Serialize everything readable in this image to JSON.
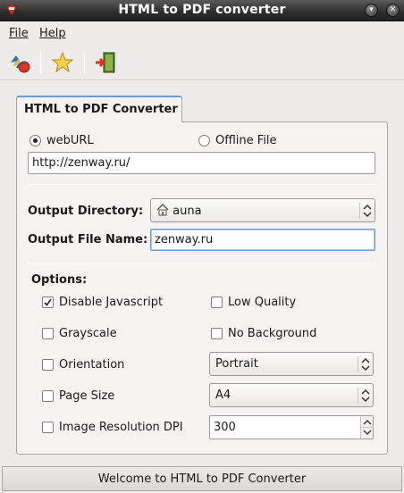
{
  "window": {
    "title": "HTML to PDF converter"
  },
  "menu": {
    "file": "File",
    "help": "Help"
  },
  "toolbar": {
    "convert_icon": "convert-icon",
    "favorite_icon": "star-icon",
    "exit_icon": "exit-door-icon"
  },
  "tab": {
    "label": "HTML to PDF Converter"
  },
  "source": {
    "weburl_label": "webURL",
    "offline_label": "Offline File",
    "selected": "webURL",
    "url_value": "http://zenway.ru/"
  },
  "output": {
    "directory_label": "Output Directory:",
    "directory_value": "auna",
    "filename_label": "Output File Name:",
    "filename_value": "zenway.ru"
  },
  "options": {
    "heading": "Options:",
    "disable_js": {
      "label": "Disable Javascript",
      "checked": true
    },
    "low_quality": {
      "label": "Low Quality",
      "checked": false
    },
    "grayscale": {
      "label": "Grayscale",
      "checked": false
    },
    "no_background": {
      "label": "No Background",
      "checked": false
    },
    "orientation": {
      "label": "Orientation",
      "checked": false,
      "value": "Portrait"
    },
    "page_size": {
      "label": "Page Size",
      "checked": false,
      "value": "A4"
    },
    "dpi": {
      "label": "Image Resolution DPI",
      "checked": false,
      "value": "300"
    }
  },
  "status": {
    "text": "Welcome to HTML to PDF Converter"
  },
  "colors": {
    "accent": "#6c9bd2",
    "titlebar": "#2d2d2d"
  }
}
